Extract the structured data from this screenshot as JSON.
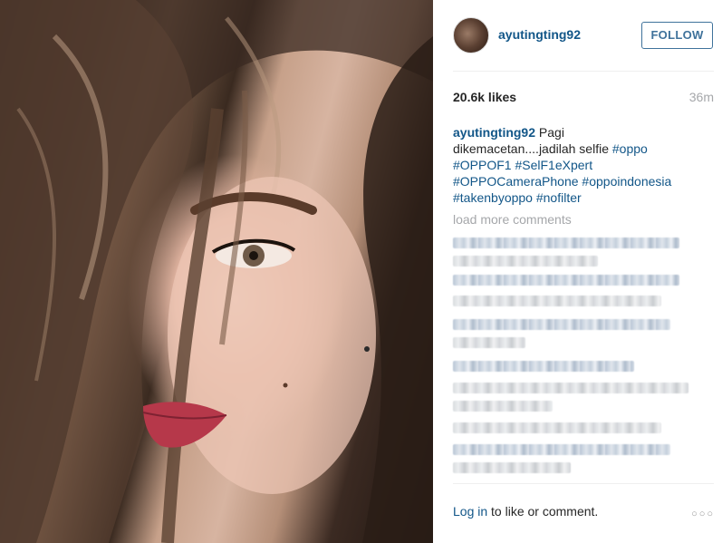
{
  "post": {
    "username": "ayutingting92",
    "follow_label": "FOLLOW",
    "likes": "20.6k likes",
    "time_ago": "36m",
    "caption_user": "ayutingting92",
    "caption_line1": " Pagi",
    "caption_line2": "dikemacetan....jadilah selfie ",
    "tags": [
      "#oppo",
      "#OPPOF1",
      "#SelF1eXpert",
      "#OPPOCameraPhone",
      "#oppoindonesia",
      "#takenbyoppo",
      "#nofilter"
    ],
    "load_more": "load more comments",
    "login_link": "Log in",
    "login_rest": " to like or comment.",
    "more_icon": "ellipsis-icon"
  }
}
